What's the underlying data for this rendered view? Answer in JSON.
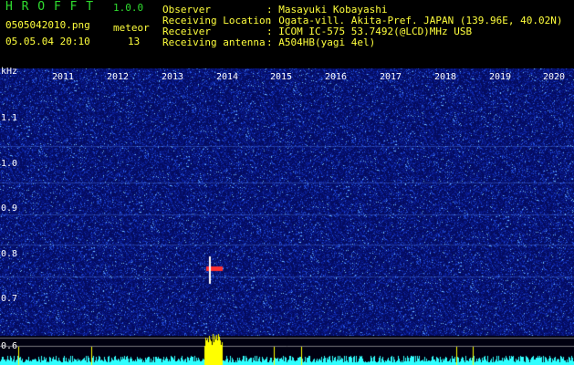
{
  "app": {
    "name": "H R O F F T",
    "version": "1.0.0",
    "filename": "0505042010.png",
    "datetime": "05.05.04 20:10",
    "meteor_label": "meteor",
    "meteor_count": "13"
  },
  "info": {
    "labels": [
      "Observer",
      "Receiving Location",
      "Receiver",
      "Receiving antenna"
    ],
    "values": [
      ": Masayuki Kobayashi",
      ": Ogata-vill. Akita-Pref. JAPAN (139.96E, 40.02N)",
      ": ICOM IC-575 53.7492(@LCD)MHz USB",
      ": A504HB(yagi 4el)"
    ]
  },
  "axis": {
    "unit": "kHz",
    "y_ticks": [
      "1.1",
      "1.0",
      "0.9",
      "0.8",
      "0.7",
      "0.6"
    ],
    "years": [
      "2011",
      "2012",
      "2013",
      "2014",
      "2015",
      "2016",
      "2017",
      "2018",
      "2019",
      "2020"
    ]
  },
  "colors": {
    "background": "#000000",
    "spectrum_base": "#06106a",
    "green_text": "#2fdc2f",
    "yellow_text": "#ffff3c",
    "meteor_echo": "#ff3030",
    "count_trace": "#30ffff",
    "count_bar": "#ffff00"
  }
}
